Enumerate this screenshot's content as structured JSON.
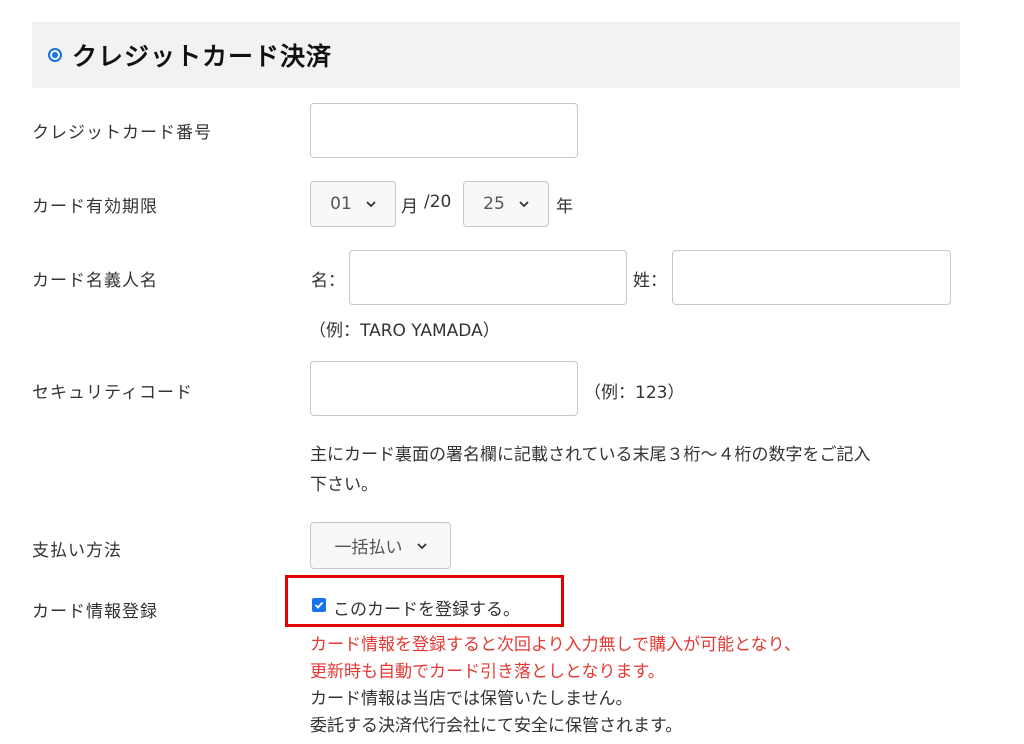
{
  "header": {
    "title": "クレジットカード決済"
  },
  "card_number": {
    "label": "クレジットカード番号",
    "value": ""
  },
  "expiry": {
    "label": "カード有効期限",
    "month": "01",
    "month_unit": "月",
    "year_prefix": "/20",
    "year": "25",
    "year_unit": "年"
  },
  "holder": {
    "label": "カード名義人名",
    "first_label": "名：",
    "last_label": "姓：",
    "first_value": "",
    "last_value": "",
    "example": "（例：TARO YAMADA）"
  },
  "security": {
    "label": "セキュリティコード",
    "value": "",
    "example": "（例：123）",
    "note_line1": "主にカード裏面の署名欄に記載されている末尾３桁～４桁の数字をご記入",
    "note_line2": "下さい。"
  },
  "payment": {
    "label": "支払い方法",
    "selected": "一括払い"
  },
  "register": {
    "label": "カード情報登録",
    "checkbox_label": "このカードを登録する。",
    "checked": true,
    "red_line1": "カード情報を登録すると次回より入力無しで購入が可能となり、",
    "red_line2": "更新時も自動でカード引き落としとなります。",
    "info_line1": "カード情報は当店では保管いたしません。",
    "info_line2": "委託する決済代行会社にて安全に保管されます。"
  },
  "colors": {
    "accent": "#1a73e8",
    "warning": "#e53935",
    "highlight": "#e00000"
  }
}
